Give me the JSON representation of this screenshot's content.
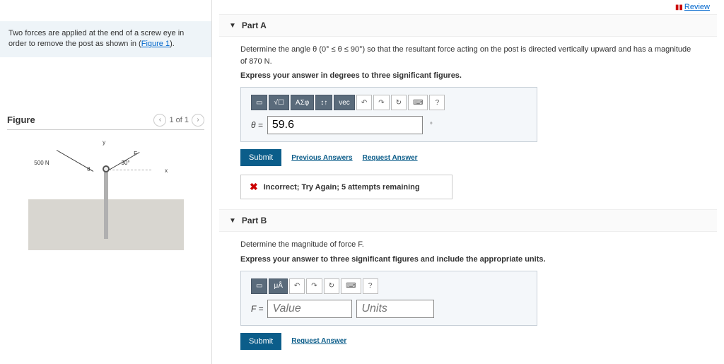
{
  "review_label": "Review",
  "problem": {
    "text_before_link": "Two forces are applied at the end of a screw eye in order to remove the post as shown in (",
    "link_text": "Figure 1",
    "text_after_link": ")."
  },
  "figure": {
    "title": "Figure",
    "counter": "1 of 1",
    "force_label": "500 N",
    "angle_label": "30°",
    "y_label": "y",
    "x_label": "x",
    "f_label": "F",
    "theta_label": "θ"
  },
  "partA": {
    "title": "Part A",
    "prompt": "Determine the angle θ (0° ≤ θ ≤ 90°) so that the resultant force acting on the post is directed vertically upward and has a magnitude of 870 N.",
    "instruction": "Express your answer in degrees to three significant figures.",
    "toolbar": {
      "t2": "√☐",
      "t3": "ΑΣφ",
      "t4": "↕↑",
      "t5": "vec",
      "undo": "↶",
      "redo": "↷",
      "reset": "↻",
      "kbd": "⌨",
      "help": "?"
    },
    "var": "θ =",
    "value": "59.6",
    "unit": "°",
    "submit": "Submit",
    "prev_answers": "Previous Answers",
    "request_answer": "Request Answer",
    "feedback": "Incorrect; Try Again; 5 attempts remaining"
  },
  "partB": {
    "title": "Part B",
    "prompt": "Determine the magnitude of force F.",
    "instruction": "Express your answer to three significant figures and include the appropriate units.",
    "toolbar": {
      "t2": "μÅ",
      "undo": "↶",
      "redo": "↷",
      "reset": "↻",
      "kbd": "⌨",
      "help": "?"
    },
    "var": "F =",
    "value_placeholder": "Value",
    "units_placeholder": "Units",
    "submit": "Submit",
    "request_answer": "Request Answer"
  }
}
